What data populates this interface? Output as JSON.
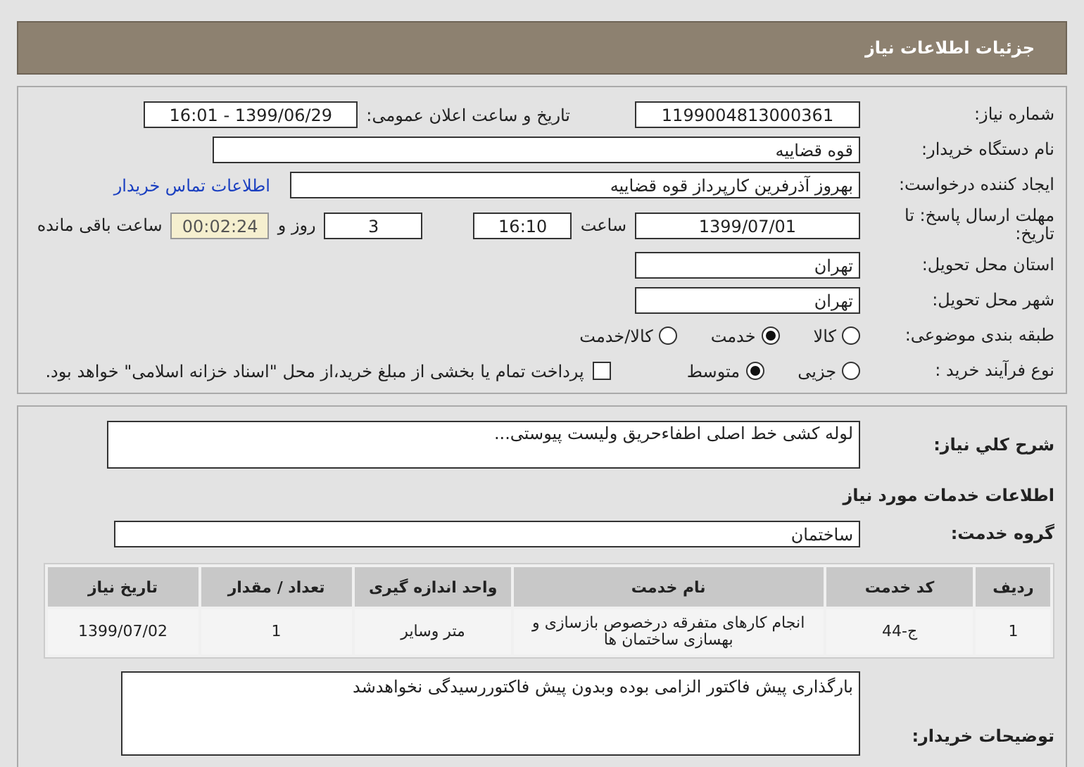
{
  "header": {
    "title": "جزئیات اطلاعات نیاز"
  },
  "need_number": {
    "label": "شماره نیاز:",
    "value": "1199004813000361"
  },
  "announce": {
    "label": "تاریخ و ساعت اعلان عمومی:",
    "value": "1399/06/29 - 16:01"
  },
  "buyer": {
    "label": "نام دستگاه خریدار:",
    "value": "قوه قضاییه"
  },
  "creator": {
    "label": "ایجاد کننده درخواست:",
    "value": "بهروز آذرفرین کارپرداز قوه قضاییه",
    "link": "اطلاعات تماس خریدار"
  },
  "deadline": {
    "label": "مهلت ارسال پاسخ: تا تاریخ:",
    "date": "1399/07/01",
    "time_label": "ساعت",
    "time": "16:10",
    "days": "3",
    "days_label": "روز و",
    "remaining": "00:02:24",
    "remaining_label": "ساعت باقی مانده"
  },
  "province": {
    "label": "استان محل تحویل:",
    "value": "تهران"
  },
  "city": {
    "label": "شهر محل تحویل:",
    "value": "تهران"
  },
  "category": {
    "label": "طبقه بندی موضوعی:",
    "options": [
      {
        "label": "کالا",
        "selected": false
      },
      {
        "label": "خدمت",
        "selected": true
      },
      {
        "label": "کالا/خدمت",
        "selected": false
      }
    ]
  },
  "process": {
    "label": "نوع فرآیند خرید :",
    "options": [
      {
        "label": "جزیی",
        "selected": false
      },
      {
        "label": "متوسط",
        "selected": true
      }
    ],
    "treasury": {
      "label": "پرداخت تمام یا بخشی از مبلغ خرید،از محل \"اسناد خزانه اسلامی\" خواهد بود.",
      "checked": false
    }
  },
  "summary": {
    "label": "شرح کلي نياز:",
    "value": "لوله کشی خط اصلی اطفاءحریق ولیست پیوستی..."
  },
  "services_heading": "اطلاعات خدمات مورد نیاز",
  "service_group": {
    "label": "گروه خدمت:",
    "value": "ساختمان"
  },
  "table": {
    "columns": [
      "ردیف",
      "کد خدمت",
      "نام خدمت",
      "واحد اندازه گیری",
      "تعداد / مقدار",
      "تاریخ نیاز"
    ],
    "rows": [
      [
        "1",
        "ج-44",
        "انجام کارهای متفرقه درخصوص بازسازی و بهسازی ساختمان ها",
        "متر وسایر",
        "1",
        "1399/07/02"
      ]
    ]
  },
  "notes": {
    "label": "توضیحات خریدار:",
    "value": "بارگذاری پیش فاکتور الزامی بوده وبدون پیش فاکتوررسیدگی نخواهدشد"
  }
}
